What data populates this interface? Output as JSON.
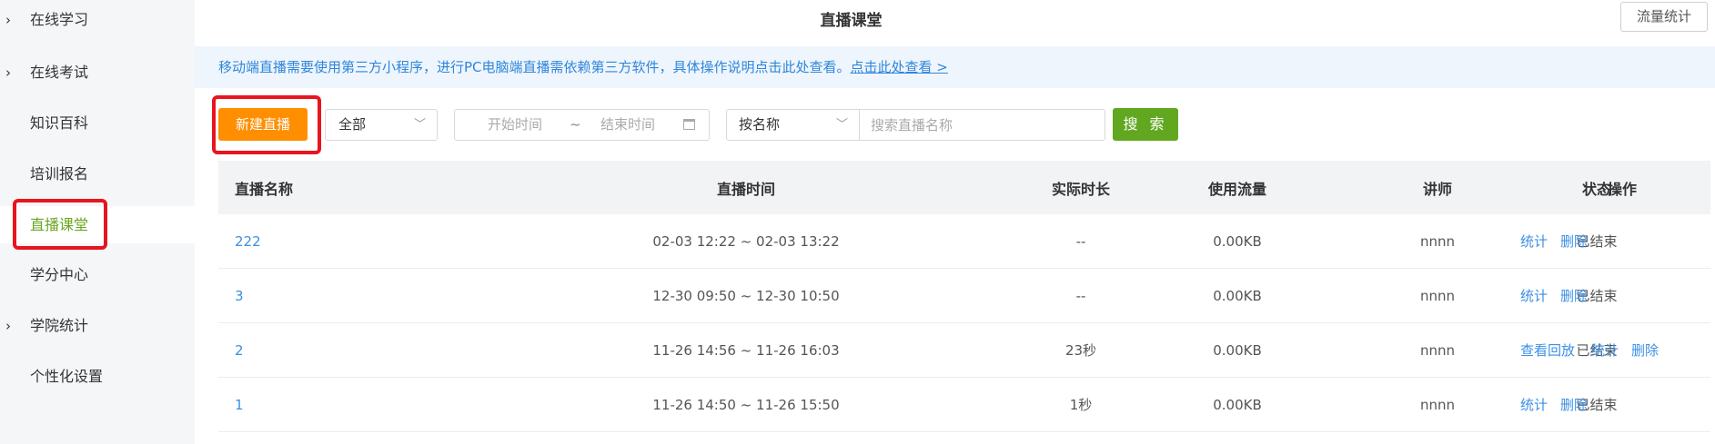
{
  "sidebar": {
    "items": [
      {
        "label": "在线学习",
        "chevron": "›"
      },
      {
        "label": "在线考试",
        "chevron": "›"
      },
      {
        "label": "知识百科",
        "chevron": ""
      },
      {
        "label": "培训报名",
        "chevron": ""
      },
      {
        "label": "直播课堂",
        "chevron": "",
        "active": true
      },
      {
        "label": "学分中心",
        "chevron": ""
      },
      {
        "label": "学院统计",
        "chevron": "›"
      },
      {
        "label": "个性化设置",
        "chevron": ""
      }
    ],
    "active_color": "#6aa521"
  },
  "header": {
    "title": "直播课堂",
    "flow_stats_button": "流量统计"
  },
  "notice": {
    "text": "移动端直播需要使用第三方小程序，进行PC电脑端直播需依赖第三方软件，具体操作说明点击此处查看。",
    "link": "点击此处查看 >"
  },
  "toolbar": {
    "new_live_button": "新建直播",
    "status_select": "全部",
    "date_start_placeholder": "开始时间",
    "date_separator": "~",
    "date_end_placeholder": "结束时间",
    "search_type_select": "按名称",
    "search_placeholder": "搜索直播名称",
    "search_button": "搜 索"
  },
  "table": {
    "headers": {
      "name": "直播名称",
      "time": "直播时间",
      "duration": "实际时长",
      "flow": "使用流量",
      "teacher": "讲师",
      "status": "状态",
      "ops": "操作"
    },
    "rows": [
      {
        "name": "222",
        "time": "02-03 12:22 ~ 02-03 13:22",
        "duration": "--",
        "flow": "0.00KB",
        "teacher": "nnnn",
        "status": "已结束",
        "ops": [
          "统计",
          "删除"
        ]
      },
      {
        "name": "3",
        "time": "12-30 09:50 ~ 12-30 10:50",
        "duration": "--",
        "flow": "0.00KB",
        "teacher": "nnnn",
        "status": "已结束",
        "ops": [
          "统计",
          "删除"
        ]
      },
      {
        "name": "2",
        "time": "11-26 14:56 ~ 11-26 16:03",
        "duration": "23秒",
        "flow": "0.00KB",
        "teacher": "nnnn",
        "status": "已结束",
        "ops": [
          "查看回放",
          "统计",
          "删除"
        ]
      },
      {
        "name": "1",
        "time": "11-26 14:50 ~ 11-26 15:50",
        "duration": "1秒",
        "flow": "0.00KB",
        "teacher": "nnnn",
        "status": "已结束",
        "ops": [
          "统计",
          "删除"
        ]
      }
    ]
  },
  "colors": {
    "new_live_button": "#ff8e00",
    "search_button": "#61a820",
    "link": "#3c8fe4",
    "highlight_box": "#e8141e"
  }
}
